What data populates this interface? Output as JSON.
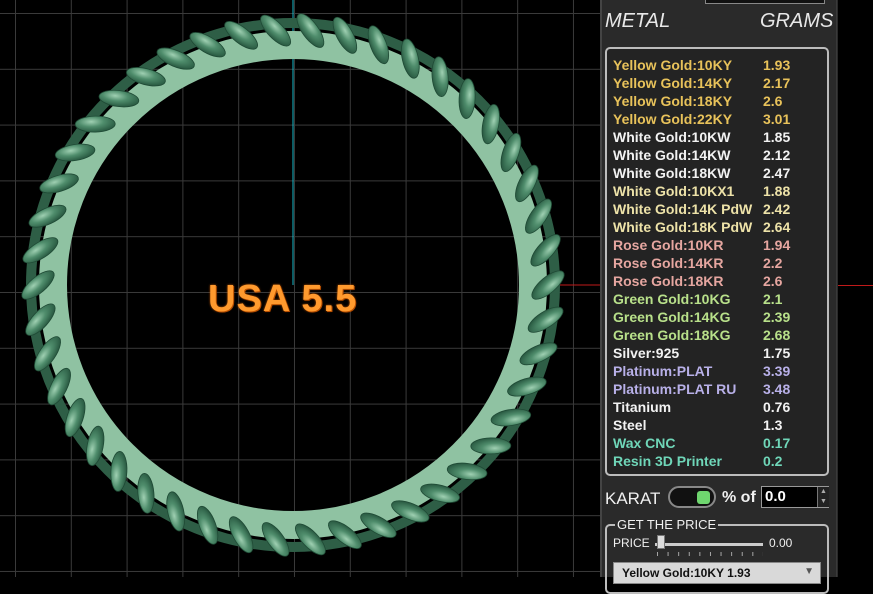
{
  "viewport": {
    "size_label": "USA 5.5"
  },
  "panel": {
    "header_metal": "METAL",
    "header_grams": "GRAMS",
    "metals": [
      {
        "name": "Yellow Gold:10KY",
        "grams": "1.93",
        "color": "#e8c25a"
      },
      {
        "name": "Yellow Gold:14KY",
        "grams": "2.17",
        "color": "#e8c25a"
      },
      {
        "name": "Yellow Gold:18KY",
        "grams": "2.6",
        "color": "#e8c25a"
      },
      {
        "name": "Yellow Gold:22KY",
        "grams": "3.01",
        "color": "#e8c25a"
      },
      {
        "name": "White Gold:10KW",
        "grams": "1.85",
        "color": "#f2f2f2"
      },
      {
        "name": "White Gold:14KW",
        "grams": "2.12",
        "color": "#f2f2f2"
      },
      {
        "name": "White Gold:18KW",
        "grams": "2.47",
        "color": "#f2f2f2"
      },
      {
        "name": "White Gold:10KX1",
        "grams": "1.88",
        "color": "#ede2a8"
      },
      {
        "name": "White Gold:14K PdW",
        "grams": "2.42",
        "color": "#ede2a8"
      },
      {
        "name": "White Gold:18K PdW",
        "grams": "2.64",
        "color": "#ede2a8"
      },
      {
        "name": "Rose Gold:10KR",
        "grams": "1.94",
        "color": "#e6a6a0"
      },
      {
        "name": "Rose Gold:14KR",
        "grams": "2.2",
        "color": "#e6a6a0"
      },
      {
        "name": "Rose Gold:18KR",
        "grams": "2.6",
        "color": "#e6a6a0"
      },
      {
        "name": "Green Gold:10KG",
        "grams": "2.1",
        "color": "#b8e08a"
      },
      {
        "name": "Green Gold:14KG",
        "grams": "2.39",
        "color": "#b8e08a"
      },
      {
        "name": "Green Gold:18KG",
        "grams": "2.68",
        "color": "#b8e08a"
      },
      {
        "name": "Silver:925",
        "grams": "1.75",
        "color": "#f2f2f2"
      },
      {
        "name": "Platinum:PLAT",
        "grams": "3.39",
        "color": "#b8b0e8"
      },
      {
        "name": "Platinum:PLAT RU",
        "grams": "3.48",
        "color": "#b8b0e8"
      },
      {
        "name": "Titanium",
        "grams": "0.76",
        "color": "#f2f2f2"
      },
      {
        "name": "Steel",
        "grams": "1.3",
        "color": "#f2f2f2"
      },
      {
        "name": "Wax  CNC",
        "grams": "0.17",
        "color": "#6fd6b8"
      },
      {
        "name": "Resin 3D Printer",
        "grams": "0.2",
        "color": "#6fd6b8"
      }
    ],
    "karat_label": "KARAT",
    "percent_label": "% of",
    "percent_value": "0.0",
    "price_legend": "GET THE PRICE",
    "price_label": "PRICE",
    "price_value": "0.00",
    "price_select_value": "Yellow Gold:10KY 1.93"
  },
  "colors": {
    "ring": "#3e7a5c",
    "ring_inner": "#8fc2a2",
    "axis_vertical": "#18b8c8",
    "axis_horizontal": "#c01a1a",
    "label": "#ff9a2e",
    "panel_bg": "#2a2a2a"
  }
}
